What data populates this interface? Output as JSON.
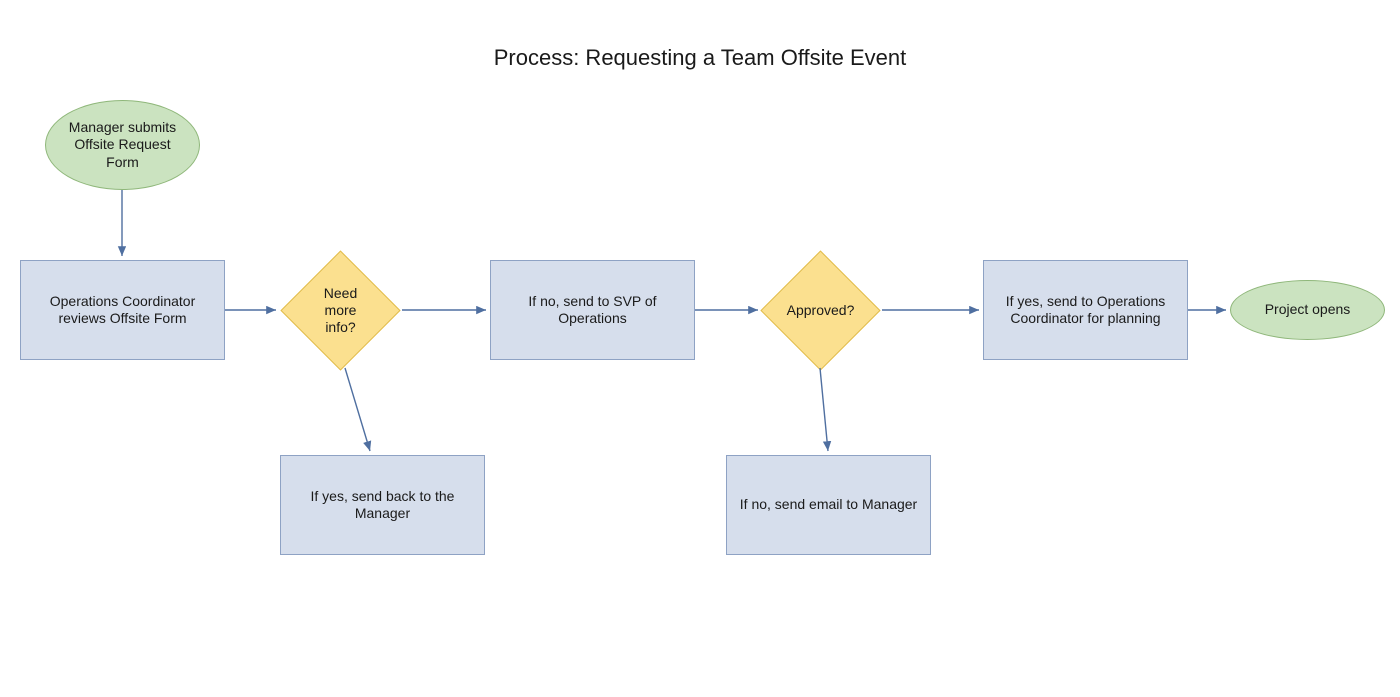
{
  "title": "Process: Requesting a Team Offsite Event",
  "nodes": {
    "start": {
      "label": "Manager submits Offsite Request Form"
    },
    "review": {
      "label": "Operations Coordinator reviews Offsite Form"
    },
    "needInfo": {
      "label": "Need more info?"
    },
    "sendBack": {
      "label": "If yes, send back to the Manager"
    },
    "toSvp": {
      "label": "If no, send to SVP of Operations"
    },
    "approved": {
      "label": "Approved?"
    },
    "emailMgr": {
      "label": "If no, send email to Manager"
    },
    "toCoord": {
      "label": "If yes, send to Operations Coordinator for planning"
    },
    "projectOpens": {
      "label": "Project opens"
    }
  },
  "colors": {
    "rectFill": "#d6deec",
    "rectStroke": "#8ea2c4",
    "ellipseFill": "#cbe3c0",
    "ellipseStroke": "#8fb77a",
    "diamondFill": "#fbe08f",
    "diamondStroke": "#e0bb4a",
    "arrow": "#4f6fa0"
  }
}
